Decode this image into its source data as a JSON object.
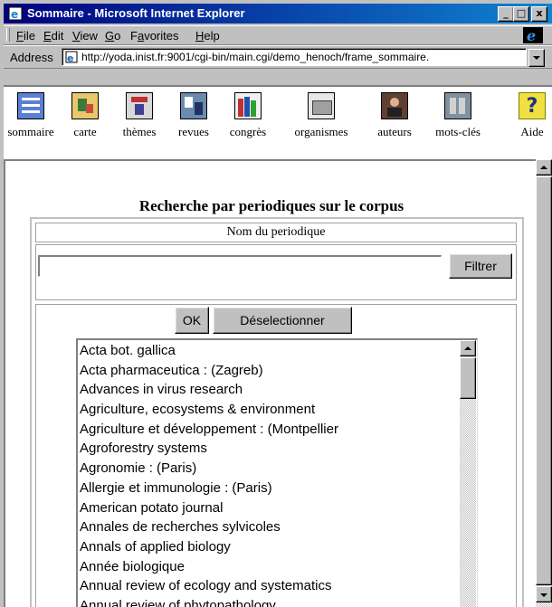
{
  "window": {
    "title": "Sommaire - Microsoft Internet Explorer",
    "min_glyph": "_",
    "max_glyph": "□",
    "close_glyph": "x"
  },
  "menu": [
    {
      "label": "File",
      "accel": "F",
      "rest": "ile"
    },
    {
      "label": "Edit",
      "accel": "E",
      "rest": "dit"
    },
    {
      "label": "View",
      "accel": "V",
      "rest": "iew"
    },
    {
      "label": "Go",
      "accel": "G",
      "rest": "o"
    },
    {
      "label": "Favorites",
      "pre": "F",
      "accel": "a",
      "rest": "vorites"
    },
    {
      "label": "Help",
      "accel": "H",
      "rest": "elp"
    }
  ],
  "address": {
    "label": "Address",
    "url": "http://yoda.inist.fr:9001/cgi-bin/main.cgi/demo_henoch/frame_sommaire."
  },
  "nav": [
    {
      "label": "sommaire",
      "icon": "list-icon"
    },
    {
      "label": "carte",
      "icon": "map-icon"
    },
    {
      "label": "thèmes",
      "icon": "themes-icon"
    },
    {
      "label": "revues",
      "icon": "journals-icon"
    },
    {
      "label": "congrès",
      "icon": "books-icon"
    },
    {
      "label": "organismes",
      "icon": "folder-icon"
    },
    {
      "label": "auteurs",
      "icon": "author-icon"
    },
    {
      "label": "mots-clés",
      "icon": "keywords-icon"
    },
    {
      "label": "Aide",
      "icon": "help-icon"
    }
  ],
  "page": {
    "title": "Recherche par periodiques sur le corpus",
    "column_header": "Nom du periodique",
    "filter_value": "",
    "filter_button": "Filtrer",
    "ok_button": "OK",
    "deselect_button": "Déselectionner"
  },
  "journals": [
    "Acta bot. gallica",
    "Acta pharmaceutica : (Zagreb)",
    "Advances in virus research",
    "Agriculture, ecosystems & environment",
    "Agriculture et développement : (Montpellier",
    "Agroforestry systems",
    "Agronomie : (Paris)",
    "Allergie et immunologie : (Paris)",
    "American potato journal",
    "Annales de recherches sylvicoles",
    "Annals of applied biology",
    "Année biologique",
    "Annual review of ecology and systematics",
    "Annual review of phytopathology"
  ],
  "colors": {
    "title_start": "#000080",
    "title_end": "#1084d0",
    "chrome": "#c0c0c0"
  }
}
